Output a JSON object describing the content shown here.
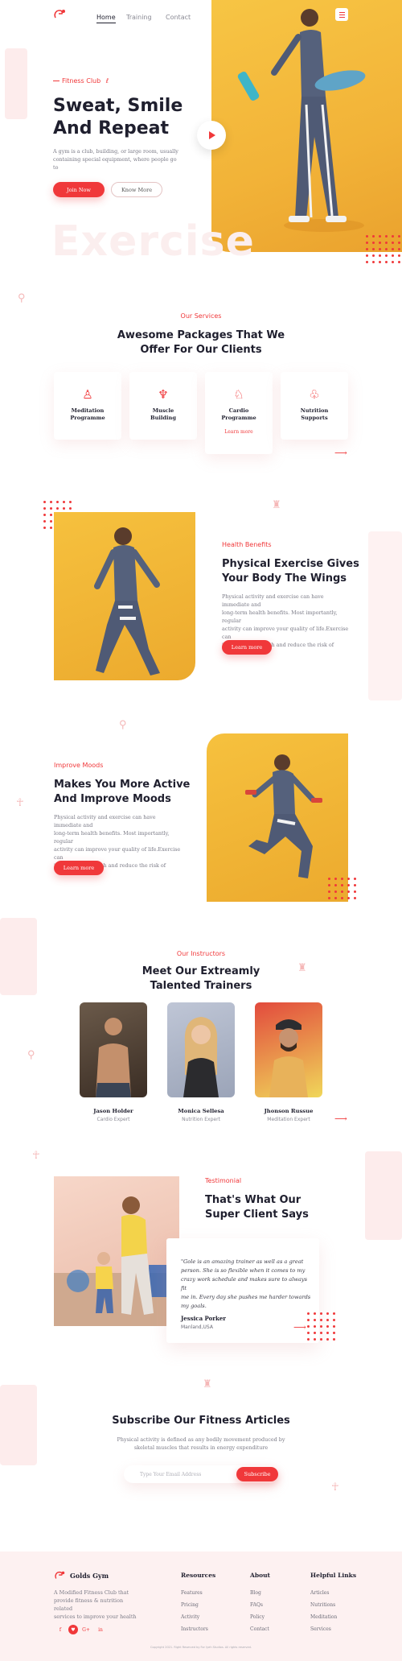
{
  "brand": {
    "name": "Golds Gym",
    "accent": "#f0383a",
    "hero_yellow": "#f4bb3f"
  },
  "nav": {
    "items": [
      "Home",
      "Training",
      "Contact"
    ],
    "active": "Home"
  },
  "hero": {
    "eyebrow": "Fitness Club",
    "title_line1": "Sweat, Smile",
    "title_line2": "And Repeat",
    "text_line1": "A gym is a club, building, or large room, usually",
    "text_line2": "containing special equipment, where people go to",
    "primary_cta": "Join Now",
    "secondary_cta": "Know More",
    "watermark": "Exercise"
  },
  "services": {
    "eyebrow": "Our Services",
    "title_line1": "Awesome Packages That We",
    "title_line2": "Offer For Our Clients",
    "items": [
      {
        "line1": "Meditation",
        "line2": "Programme",
        "icon": "meditation-icon"
      },
      {
        "line1": "Muscle",
        "line2": "Building",
        "icon": "dumbbell-icon"
      },
      {
        "line1": "Cardio",
        "line2": "Programme",
        "icon": "cardio-icon",
        "more": "Learn more"
      },
      {
        "line1": "Nutrition",
        "line2": "Supports",
        "icon": "nutrition-icon"
      }
    ]
  },
  "health": {
    "eyebrow": "Health Benefits",
    "title_line1": "Physical Exercise Gives",
    "title_line2": "Your Body The Wings",
    "text": [
      "Physical activity and exercise can have immediate and",
      "long-term health benefits. Most importantly, regular",
      "activity can improve your quality of life.Exercise can",
      "improve your health and reduce the risk of"
    ],
    "cta": "Learn more"
  },
  "moods": {
    "eyebrow": "Improve Moods",
    "title_line1": "Makes You More Active",
    "title_line2": "And Improve Moods",
    "text": [
      "Physical activity and exercise can have immediate and",
      "long-term health benefits. Most importantly, regular",
      "activity can improve your quality of life.Exercise can",
      "improve your health and reduce the risk of"
    ],
    "cta": "Learn more"
  },
  "instructors": {
    "eyebrow": "Our Instructors",
    "title_line1": "Meet Our Extreamly",
    "title_line2": "Talented Trainers",
    "people": [
      {
        "name": "Jason Holder",
        "role": "Cardio Expert"
      },
      {
        "name": "Monica Sellesa",
        "role": "Nutrition Expert"
      },
      {
        "name": "Jhonson Russue",
        "role": "Meditation Expert"
      }
    ]
  },
  "testimonial": {
    "eyebrow": "Testimonial",
    "title_line1": "That's What Our",
    "title_line2": "Super Client Says",
    "quote": [
      "\"Gole is an amazing trainer as well as a great",
      "person. She is so flexible when it comes to my",
      "crazy work schedule and makes sure to always fit",
      "me in. Every day she pushes me harder towards",
      "my goals."
    ],
    "author": "Jessica Porker",
    "location": "Manland,USA"
  },
  "subscribe": {
    "title": "Subscribe Our Fitness Articles",
    "text_line1": "Physical activity is defined as any bodily movement produced by",
    "text_line2": "skeletal muscles that results in energy expenditure",
    "placeholder": "Type Your Email Address",
    "cta": "Subscribe"
  },
  "footer": {
    "about_line1": "A Modified Fitness Club that",
    "about_line2": "provide fitness & nutrition related",
    "about_line3": "services to improve your health",
    "social": [
      "f",
      "♥",
      "G+",
      "in"
    ],
    "columns": [
      {
        "title": "Resources",
        "links": [
          "Features",
          "Pricing",
          "Activity",
          "Instructors"
        ]
      },
      {
        "title": "About",
        "links": [
          "Blog",
          "FAQs",
          "Policy",
          "Contact"
        ]
      },
      {
        "title": "Helpful Links",
        "links": [
          "Articles",
          "Nutritions",
          "Meditation",
          "Services"
        ]
      }
    ],
    "copyright": "Copyright 2021. Right Reserved by For Iyeh Studios. All rights reserved."
  }
}
